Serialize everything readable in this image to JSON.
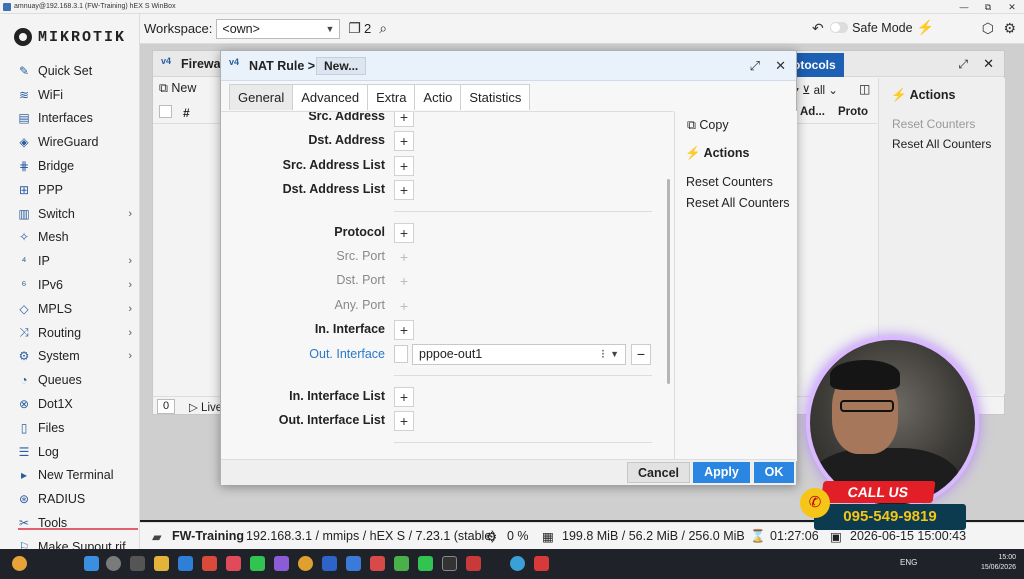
{
  "os": {
    "title": "amnuay@192.168.3.1 (FW-Training) hEX S WinBox",
    "min": "—",
    "max": "⧉",
    "close": "✕"
  },
  "brand": {
    "logo_text": "MIKROTIK",
    "accent": "#2a86e0"
  },
  "sidebar": {
    "items": [
      {
        "label": "Quick Set",
        "icon": "wand-icon",
        "glyph": "✎",
        "arrow": ""
      },
      {
        "label": "WiFi",
        "icon": "wifi-icon",
        "glyph": "≋",
        "arrow": ""
      },
      {
        "label": "Interfaces",
        "icon": "interfaces-icon",
        "glyph": "▤",
        "arrow": ""
      },
      {
        "label": "WireGuard",
        "icon": "wireguard-icon",
        "glyph": "◈",
        "arrow": ""
      },
      {
        "label": "Bridge",
        "icon": "bridge-icon",
        "glyph": "⋕",
        "arrow": ""
      },
      {
        "label": "PPP",
        "icon": "ppp-icon",
        "glyph": "⊞",
        "arrow": ""
      },
      {
        "label": "Switch",
        "icon": "switch-icon",
        "glyph": "▥",
        "arrow": "›"
      },
      {
        "label": "Mesh",
        "icon": "mesh-icon",
        "glyph": "✧",
        "arrow": ""
      },
      {
        "label": "IP",
        "icon": "ip-icon",
        "glyph": "⁴",
        "arrow": "›"
      },
      {
        "label": "IPv6",
        "icon": "ipv6-icon",
        "glyph": "⁶",
        "arrow": "›"
      },
      {
        "label": "MPLS",
        "icon": "mpls-icon",
        "glyph": "◇",
        "arrow": "›"
      },
      {
        "label": "Routing",
        "icon": "routing-icon",
        "glyph": "⤨",
        "arrow": "›"
      },
      {
        "label": "System",
        "icon": "gear-icon",
        "glyph": "⚙",
        "arrow": "›"
      },
      {
        "label": "Queues",
        "icon": "queues-icon",
        "glyph": "◔",
        "arrow": ""
      },
      {
        "label": "Dot1X",
        "icon": "dot1x-icon",
        "glyph": "⊗",
        "arrow": ""
      },
      {
        "label": "Files",
        "icon": "files-icon",
        "glyph": "▯",
        "arrow": ""
      },
      {
        "label": "Log",
        "icon": "log-icon",
        "glyph": "☰",
        "arrow": ""
      },
      {
        "label": "New Terminal",
        "icon": "terminal-icon",
        "glyph": "▸",
        "arrow": ""
      },
      {
        "label": "RADIUS",
        "icon": "radius-icon",
        "glyph": "⊛",
        "arrow": ""
      },
      {
        "label": "Tools",
        "icon": "tools-icon",
        "glyph": "✂",
        "arrow": ""
      },
      {
        "label": "Make Supout.rif",
        "icon": "supout-icon",
        "glyph": "⚐",
        "arrow": ""
      }
    ]
  },
  "topbar": {
    "workspace_label": "Workspace:",
    "workspace_value": "<own>",
    "window_count": "2",
    "safe_mode_label": "Safe Mode"
  },
  "firewall": {
    "title": "Firewa",
    "v4": "v4",
    "protocols_tab": "otocols",
    "new_label": "New",
    "filter_value": "all",
    "col_hash": "#",
    "col_address": "Ad...",
    "col_proto": "Proto",
    "count": "0",
    "live_label": "Live",
    "actions_title": "Actions",
    "reset_counters": "Reset Counters",
    "reset_all_counters": "Reset All Counters"
  },
  "dialog": {
    "v4": "v4",
    "title": "NAT Rule >",
    "subtitle": "New...",
    "tabs": [
      "General",
      "Advanced",
      "Extra",
      "Actio",
      "Statistics"
    ],
    "fields": {
      "src_address": "Src. Address",
      "dst_address": "Dst. Address",
      "src_address_list": "Src. Address List",
      "dst_address_list": "Dst. Address List",
      "protocol": "Protocol",
      "src_port": "Src. Port",
      "dst_port": "Dst. Port",
      "any_port": "Any. Port",
      "in_interface": "In. Interface",
      "out_interface": "Out. Interface",
      "out_interface_value": "pppoe-out1",
      "in_interface_list": "In. Interface List",
      "out_interface_list": "Out. Interface List"
    },
    "side": {
      "copy": "Copy",
      "actions_title": "Actions",
      "reset_counters": "Reset Counters",
      "reset_all_counters": "Reset All Counters"
    },
    "buttons": {
      "cancel": "Cancel",
      "apply": "Apply",
      "ok": "OK"
    }
  },
  "status": {
    "identity": "FW-Training",
    "info": "192.168.3.1 / mmips / hEX S / 7.23.1 (stable)",
    "cpu": "0 %",
    "memory": "199.8 MiB / 56.2 MiB / 256.0 MiB",
    "uptime": "01:27:06",
    "datetime": "2026-06-15 15:00:43"
  },
  "overlay": {
    "call_us": "CALL US",
    "phone": "095-549-9819"
  },
  "taskbar": {
    "lang": "ENG",
    "time": "15:00",
    "date": "15/06/2026"
  }
}
